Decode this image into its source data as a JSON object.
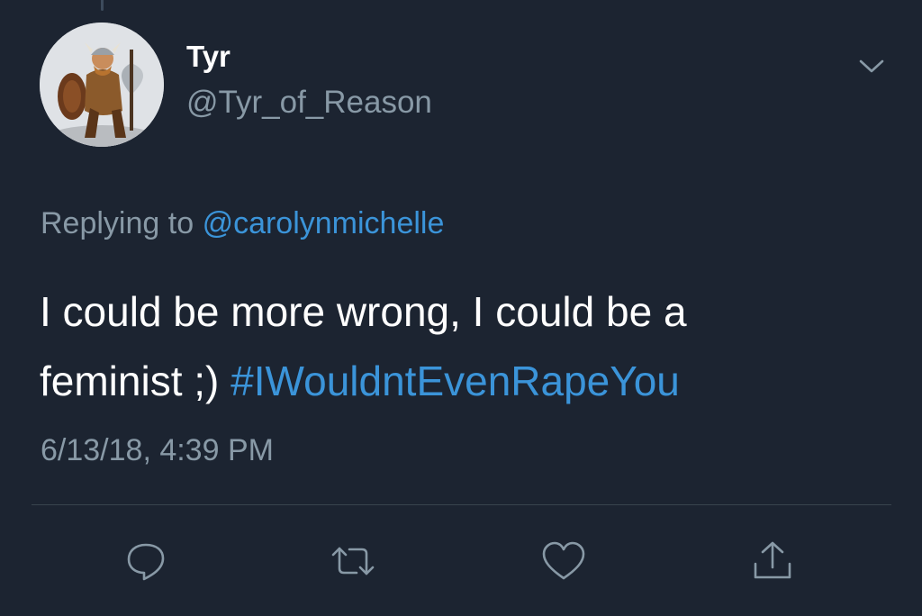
{
  "tweet": {
    "author": {
      "display_name": "Tyr",
      "handle": "@Tyr_of_Reason"
    },
    "replying_prefix": "Replying to",
    "replying_to": "@carolynmichelle",
    "text_line1": "I could be more wrong, I could be a",
    "text_line2_prefix": "feminist ;) ",
    "hashtag": "#IWouldntEvenRapeYou",
    "timestamp": "6/13/18, 4:39 PM"
  },
  "actions": [
    {
      "name": "reply",
      "icon": "speech-bubble-icon"
    },
    {
      "name": "retweet",
      "icon": "retweet-icon"
    },
    {
      "name": "like",
      "icon": "heart-icon"
    },
    {
      "name": "share",
      "icon": "share-icon"
    }
  ],
  "colors": {
    "background": "#1c2431",
    "secondary_text": "#8899a6",
    "link": "#3b94d9",
    "divider": "#38444d"
  }
}
